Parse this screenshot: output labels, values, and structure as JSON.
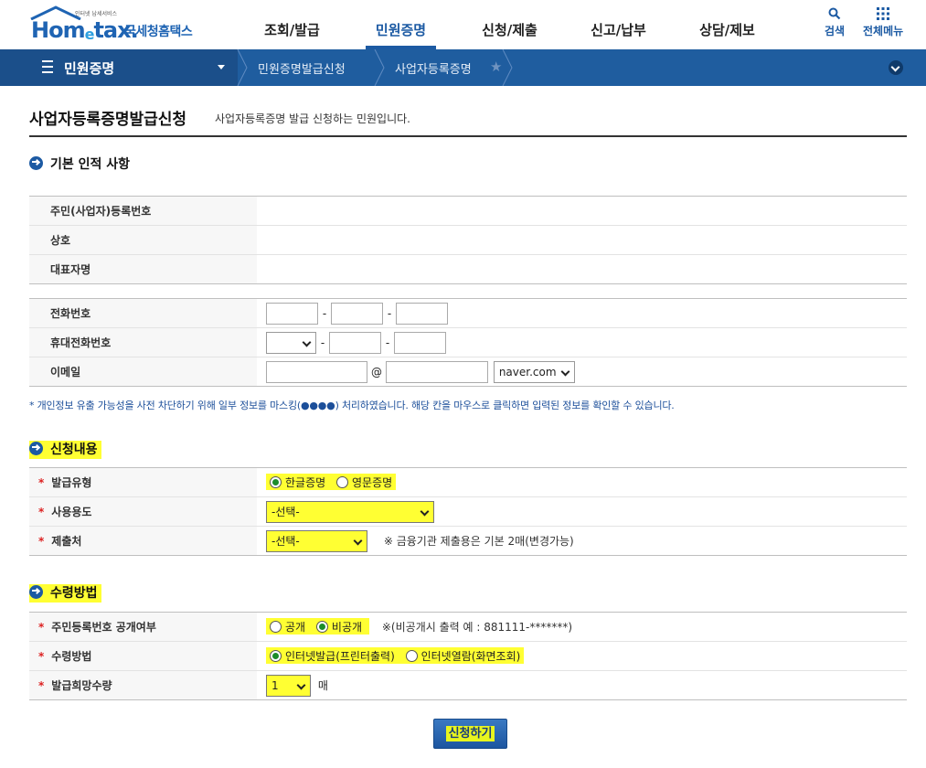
{
  "header": {
    "logo_tagline": "인터넷 납세서비스",
    "logo_word_a": "Hom",
    "logo_word_e": "e",
    "logo_word_b": "tax.",
    "logo_kr": "국세청홈택스",
    "nav": [
      "조회/발급",
      "민원증명",
      "신청/제출",
      "신고/납부",
      "상담/제보"
    ],
    "active_nav": "민원증명",
    "search_label": "검색",
    "menu_label": "전체메뉴"
  },
  "breadcrumb": {
    "first": "민원증명",
    "second": "민원증명발급신청",
    "third": "사업자등록증명"
  },
  "page": {
    "title": "사업자등록증명발급신청",
    "description": "사업자등록증명 발급 신청하는 민원입니다."
  },
  "basic": {
    "section_title": "기본 인적 사항",
    "rows": [
      {
        "label": "주민(사업자)등록번호",
        "value": ""
      },
      {
        "label": "상호",
        "value": ""
      },
      {
        "label": "대표자명",
        "value": ""
      }
    ],
    "phone_label": "전화번호",
    "mobile_label": "휴대전화번호",
    "email_label": "이메일",
    "email_at": "@",
    "email_domain": "naver.com",
    "dash": "-",
    "note": "* 개인정보 유출 가능성을 사전 차단하기 위해 일부 정보를 마스킹(●●●●) 처리하였습니다. 해당 칸을 마우스로 클릭하면 입력된 정보를 확인할 수 있습니다."
  },
  "apply": {
    "section_title": "신청내용",
    "req_mark": "*",
    "type_label": "발급유형",
    "type_opt1": "한글증명",
    "type_opt2": "영문증명",
    "use_label": "사용용도",
    "use_value": "-선택-",
    "submit_to_label": "제출처",
    "submit_to_value": "-선택-",
    "submit_to_hint": "※ 금융기관 제출용은 기본 2매(변경가능)"
  },
  "receive": {
    "section_title": "수령방법",
    "disclose_label": "주민등록번호 공개여부",
    "disclose_opt1": "공개",
    "disclose_opt2": "비공개",
    "disclose_hint": "※(비공개시 출력 예 : 881111-*******)",
    "method_label": "수령방법",
    "method_opt1": "인터넷발급(프린터출력)",
    "method_opt2": "인터넷열람(화면조회)",
    "qty_label": "발급희망수량",
    "qty_value": "1",
    "qty_unit": "매"
  },
  "submit_label": "신청하기"
}
